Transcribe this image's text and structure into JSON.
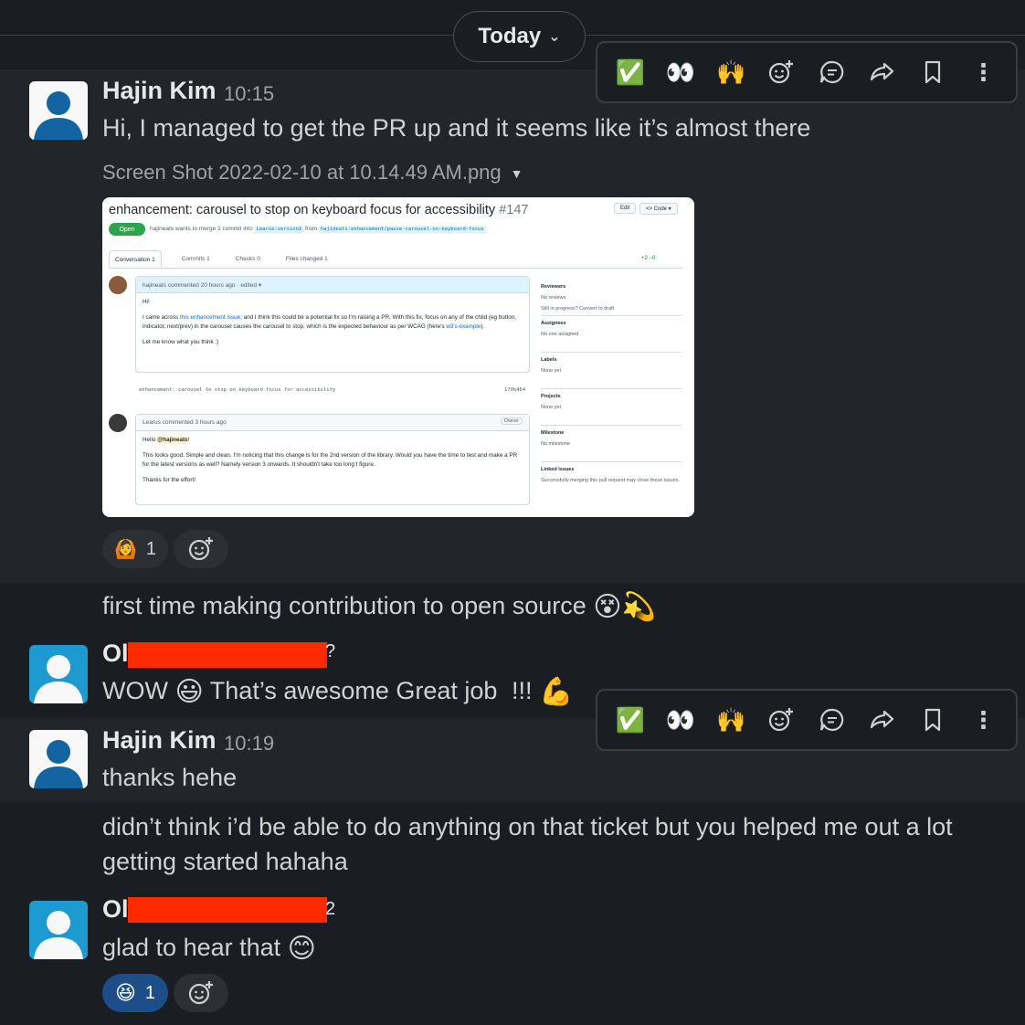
{
  "date_divider": {
    "label": "Today"
  },
  "toolbar_actions": [
    {
      "name": "check-mark",
      "glyph": "✅"
    },
    {
      "name": "eyes",
      "glyph": "👀"
    },
    {
      "name": "raised-hands",
      "glyph": "🙌"
    },
    {
      "name": "add-reaction",
      "glyph": ""
    },
    {
      "name": "reply-in-thread",
      "glyph": ""
    },
    {
      "name": "forward",
      "glyph": ""
    },
    {
      "name": "save",
      "glyph": ""
    },
    {
      "name": "more-actions",
      "glyph": "⋮"
    }
  ],
  "messages": {
    "m1": {
      "author": "Hajin Kim",
      "time": "10:15",
      "text": "Hi, I managed to get the PR up and it seems like it’s almost there",
      "attachment": {
        "filename": "Screen Shot 2022-02-10 at 10.14.49 AM.png",
        "pr_title": "enhancement: carousel to stop on keyboard focus for accessibility",
        "pr_number": "#147",
        "status": "Open",
        "merge_text": "hajineats wants to merge 1 commit into",
        "base_branch": "Learus:version2",
        "from_word": "from",
        "head_branch": "hajineats:enhancement/pause-carousel-on-keyboard-focus",
        "edit_label": "Edit",
        "code_label": "<> Code ▾",
        "tabs": [
          "Conversation 1",
          "Commits 1",
          "Checks 0",
          "Files changed 1"
        ],
        "diffstat": "+2 −0",
        "comment1_head": "hajineats commented 20 hours ago · edited ▾",
        "comment1_hi": "Hi!",
        "comment1_p1_a": "I came across",
        "comment1_p1_link": "this enhancement issue",
        "comment1_p1_b": ", and I think this could be a potential fix so I'm raising a PR. With this fix, focus on any of the child (eg button, indicator, next/prev) in the carousel causes the carousel to stop, which is the expected behaviour as per WCAG (here's",
        "comment1_p1_link2": "w3's example",
        "comment1_p1_c": ").",
        "comment1_p2": "Let me know what you think :)",
        "commit_msg": "enhancement: carousel to stop on keyboard focus for accessibility",
        "commit_sha": "170b464",
        "comment2_head": "Learus commented 3 hours ago",
        "comment2_owner": "Owner",
        "comment2_hello": "Hello",
        "comment2_mention": "@hajineats",
        "comment2_hello_end": "!",
        "comment2_p1": "This looks good. Simple and clean. I'm noticing that this change is for the 2nd version of the library. Would you have the time to test and make a PR for the latest versions as well? Namely version 3 onwards. It shouldn't take too long I figure.",
        "comment2_p2": "Thanks for the effort!",
        "sidebar": [
          {
            "heading": "Reviewers",
            "text": "No reviews",
            "text2": "Still in progress? Convert to draft"
          },
          {
            "heading": "Assignees",
            "text": "No one assigned",
            "text2": ""
          },
          {
            "heading": "Labels",
            "text": "None yet",
            "text2": ""
          },
          {
            "heading": "Projects",
            "text": "None yet",
            "text2": ""
          },
          {
            "heading": "Milestone",
            "text": "No milestone",
            "text2": ""
          },
          {
            "heading": "Linked issues",
            "text": "Successfully merging this pull request may close these issues.",
            "text2": ""
          }
        ]
      },
      "reaction": {
        "emoji": "🙆",
        "count": "1"
      }
    },
    "m2": {
      "text": "first time making contribution to open source",
      "emojis": "😵💫"
    },
    "m3": {
      "author_visible": "Ol",
      "author_tail": "?",
      "text_a": "WOW",
      "emoji_a": "😃",
      "text_b": "That’s awesome Great job",
      "text_c": "!!!",
      "emoji_b": "💪"
    },
    "m4": {
      "author": "Hajin Kim",
      "time": "10:19",
      "text": "thanks hehe"
    },
    "m5": {
      "line1": "didn’t think i’d be able to do anything on that ticket but you helped me out a lot",
      "line2": "getting started hahaha"
    },
    "m6": {
      "author_visible": "Ol",
      "author_tail": "2",
      "text": "glad to hear that",
      "emoji": "😊",
      "reaction": {
        "emoji": "😆",
        "count": "1"
      }
    }
  },
  "colors": {
    "background": "#1a1d21",
    "hover_background": "#222529",
    "avatar_blue": "#1264a3",
    "redaction": "#ff2a00",
    "active_reaction": "#1d4e89",
    "github_green": "#2da44e"
  }
}
